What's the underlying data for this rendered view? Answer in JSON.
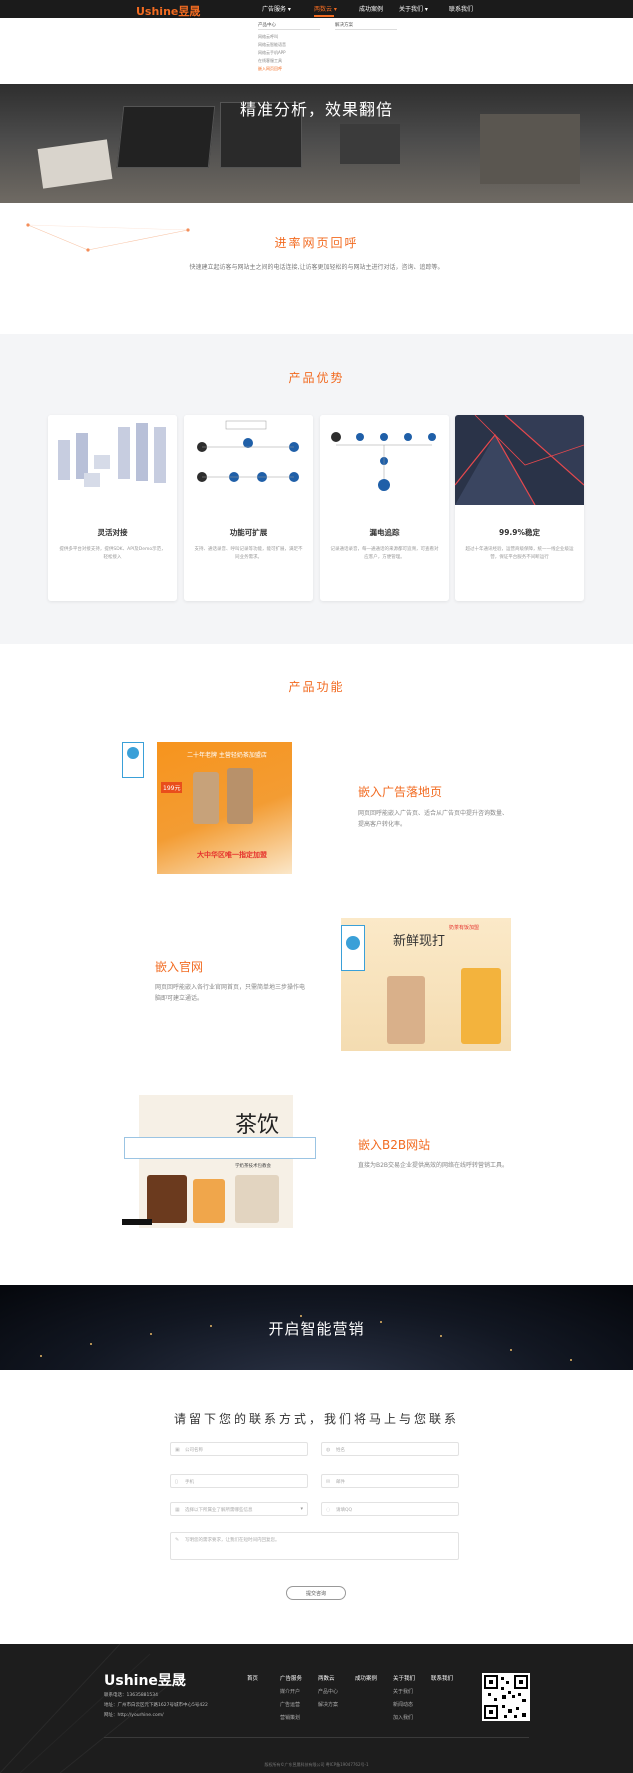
{
  "nav": {
    "logo": "Ushine昱晟",
    "items": [
      "广告服务 ▾",
      "两数云 ▾",
      "成功案例",
      "关于我们 ▾",
      "联系我们"
    ],
    "accent": "#f26b21"
  },
  "dropdown": {
    "col1_head": "产品中心",
    "col2_head": "解决方案",
    "items": [
      "网络云呼叫",
      "网络云智能语音",
      "网络云手机APP",
      "在线客服工具",
      "嵌入网页回呼"
    ]
  },
  "hero": {
    "title": "精准分析，效果翻倍"
  },
  "intro": {
    "title": "进率网页回呼",
    "desc": "快速建立起访客与网站主之间的电话连接,让访客更加轻松的与网站主进行对话，咨询、追踪等。"
  },
  "advantages": {
    "title": "产品优势",
    "cards": [
      {
        "title": "灵活对接",
        "desc": "提供多平台对接支持，提供SDK、API及Demo示范，轻松接入"
      },
      {
        "title": "功能可扩展",
        "desc": "支持、通话录音、呼叫记录等功能，能可扩展，满足不同业务需求。"
      },
      {
        "title": "漏电追踪",
        "desc": "记录通话录音，每一通通话的来源都可追溯，可查看对应客户，方便管理。"
      },
      {
        "title": "99.9%稳定",
        "desc": "超过十年通讯经验，运营商级保障，统一一线企业级运营，保证平台服务不间断运行"
      }
    ]
  },
  "functions": {
    "title": "产品功能",
    "items": [
      {
        "title": "嵌入广告落地页",
        "desc": "网页回呼能嵌入广告页、适合从广告页中提升咨询数量、提高客户转化率。"
      },
      {
        "title": "嵌入官网",
        "desc": "网页回呼能嵌入各行业官网首页，只需简单地三步操作电脑即可建立通话。"
      },
      {
        "title": "嵌入B2B网站",
        "desc": "直接为B2B交易企业提供高效的网络在线呼转营销工具。"
      }
    ],
    "img1_texts": [
      "二十年老牌  主营轻奶茶加盟店",
      "大中华区唯一指定加盟",
      "199元"
    ],
    "img2_texts": [
      "新鲜现打",
      "奶茶有饭加盟"
    ],
    "img3_texts": [
      "茶饮",
      "学奶茶技术包教会"
    ]
  },
  "cta": {
    "title": "开启智能营销"
  },
  "contact": {
    "title": "请留下您的联系方式，我们将马上与您联系",
    "fields": {
      "company": "公司名称",
      "name": "姓名",
      "phone": "手机",
      "email": "邮件",
      "industry": "选择以下所属业了解所需哪些信息",
      "qq": "请填QQ",
      "message": "写明您的需求要求，让我们在短时间内回复您。"
    },
    "submit": "提交咨询"
  },
  "footer": {
    "logo": "Ushine昱晟",
    "phone": "联系电话：13635881534",
    "address": "地址：广州市白云区元下路1627号城市中心5号422",
    "site": "网址：http://yourhine.com/",
    "columns": [
      {
        "head": "首页",
        "links": []
      },
      {
        "head": "广告服务",
        "links": [
          "媒介开户",
          "广告运营",
          "营销策划"
        ]
      },
      {
        "head": "两数云",
        "links": [
          "产品中心",
          "解决方案"
        ]
      },
      {
        "head": "成功案例",
        "links": []
      },
      {
        "head": "关于我们",
        "links": [
          "关于我们",
          "新闻动态",
          "加入我们"
        ]
      },
      {
        "head": "联系我们",
        "links": []
      }
    ],
    "copyright": "版权所有©广东昱晟科技有限公司  粤ICP备19047762号-1"
  }
}
